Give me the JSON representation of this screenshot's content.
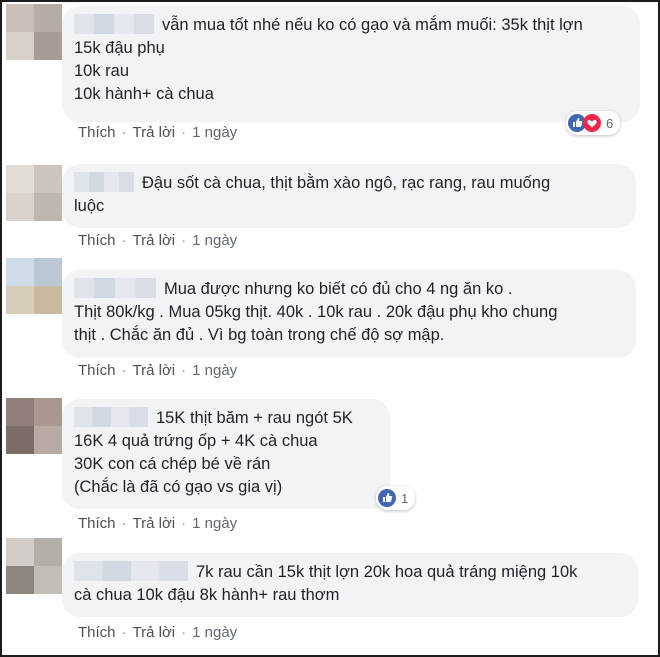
{
  "comments": [
    {
      "lines": [
        "vẫn mua tốt nhé nếu ko có gạo và mắm muối: 35k thịt lợn",
        "15k đậu phụ",
        "10k rau",
        "10k hành+ cà chua"
      ],
      "actions": {
        "like": "Thích",
        "reply": "Trả lời",
        "time": "1 ngày"
      },
      "reactions": {
        "count": "6",
        "icons": [
          "like-icon",
          "love-icon"
        ]
      },
      "avatar_colors": [
        "#c9c0b8",
        "#b7aca4",
        "#d6d0c8",
        "#a79c94"
      ]
    },
    {
      "lines": [
        "Đậu sốt cà chua, thịt bằm xào ngô, rạc rang, rau muống",
        "luộc"
      ],
      "actions": {
        "like": "Thích",
        "reply": "Trả lời",
        "time": "1 ngày"
      },
      "avatar_colors": [
        "#e2ddd6",
        "#cdc4bb",
        "#d9d3cc",
        "#bfb6ad"
      ]
    },
    {
      "lines": [
        "Mua được nhưng ko biết có đủ cho 4 ng ăn ko .",
        "Thịt 80k/kg . Mua 05kg thịt. 40k . 10k rau . 20k đậu phụ kho chung",
        "thịt . Chắc ăn đủ . Vì bg toàn trong chế độ sợ mập."
      ],
      "actions": {
        "like": "Thích",
        "reply": "Trả lời",
        "time": "1 ngày"
      },
      "avatar_colors": [
        "#cfdbe6",
        "#b9c8d4",
        "#d8cdb7",
        "#c8b99f"
      ]
    },
    {
      "lines": [
        "15K thịt băm + rau ngót 5K",
        "16K 4 quả trứng ốp + 4K cà chua",
        "30K con cá chép bé về rán",
        "(Chắc là đã có gạo vs gia vị)"
      ],
      "actions": {
        "like": "Thích",
        "reply": "Trả lời",
        "time": "1 ngày"
      },
      "reactions": {
        "count": "1",
        "icons": [
          "like-icon"
        ]
      },
      "avatar_colors": [
        "#8f7f78",
        "#a99790",
        "#7c6c66",
        "#b8a9a2"
      ]
    },
    {
      "lines": [
        "7k rau cần 15k thịt lợn 20k hoa quả tráng miệng 10k",
        "cà chua 10k đậu 8k hành+ rau thơm"
      ],
      "actions": {
        "like": "Thích",
        "reply": "Trả lời",
        "time": "1 ngày"
      },
      "avatar_colors": [
        "#d2cdc8",
        "#b4aea8",
        "#8d8580",
        "#c3bdb7"
      ]
    }
  ],
  "colors": {
    "like_blue": "#4267b2",
    "love_red": "#f0284a",
    "bubble_bg": "#f2f3f5",
    "meta_gray": "#606770"
  }
}
